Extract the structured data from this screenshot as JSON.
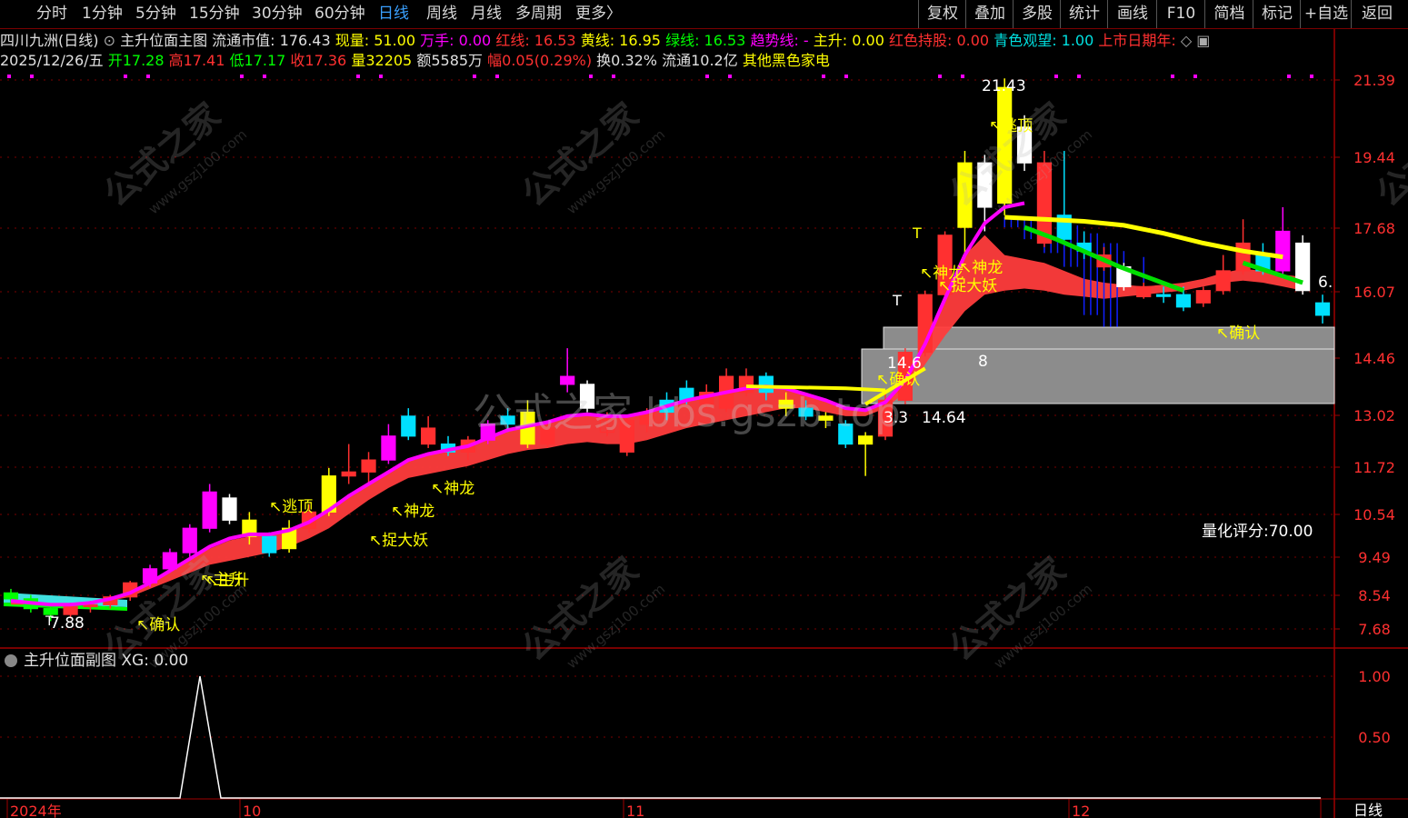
{
  "toolbar": {
    "timeframes": [
      "分时",
      "1分钟",
      "5分钟",
      "15分钟",
      "30分钟",
      "60分钟",
      "日线",
      "周线",
      "月线",
      "多周期",
      "更多"
    ],
    "active": "日线",
    "more_arrow": "〉",
    "buttons": [
      "复权",
      "叠加",
      "多股",
      "统计",
      "画线",
      "F10",
      "简档",
      "标记",
      "+自选",
      "返回"
    ]
  },
  "info_line1": {
    "stock": "四川九洲(日线)",
    "indicator": "主升位面主图",
    "items": [
      {
        "label": "流通市值: ",
        "value": "176.43",
        "color": "#e0e0e0"
      },
      {
        "label": "现量: ",
        "value": "51.00",
        "color": "#ffff00"
      },
      {
        "label": "万手: ",
        "value": "0.00",
        "color": "#ff00ff"
      },
      {
        "label": "红线: ",
        "value": "16.53",
        "color": "#ff3030"
      },
      {
        "label": "黄线: ",
        "value": "16.95",
        "color": "#ffff00"
      },
      {
        "label": "绿线: ",
        "value": "16.53",
        "color": "#00ff00"
      },
      {
        "label": "趋势线: ",
        "value": "-",
        "color": "#ff00ff"
      },
      {
        "label": "主升: ",
        "value": "0.00",
        "color": "#ffff00"
      },
      {
        "label": "红色持股: ",
        "value": "0.00",
        "color": "#ff3030"
      },
      {
        "label": "青色观望: ",
        "value": "1.00",
        "color": "#00e0e0"
      },
      {
        "label": "上市日期年: ",
        "value": "",
        "color": "#ff3030"
      }
    ]
  },
  "info_line2": {
    "date": "2025/12/26/五",
    "items": [
      {
        "label": "开",
        "value": "17.28",
        "color": "#00ff00"
      },
      {
        "label": "高",
        "value": "17.41",
        "color": "#ff3030"
      },
      {
        "label": "低",
        "value": "17.17",
        "color": "#00ff00"
      },
      {
        "label": "收",
        "value": "17.36",
        "color": "#ff3030"
      },
      {
        "label": "量",
        "value": "32205",
        "color": "#ffff00"
      },
      {
        "label": "额",
        "value": "5585万",
        "color": "#e0e0e0"
      },
      {
        "label": "幅",
        "value": "0.05(0.29%)",
        "color": "#ff3030"
      },
      {
        "label": "换",
        "value": "0.32%",
        "color": "#e0e0e0"
      },
      {
        "label": "流通",
        "value": "10.2亿",
        "color": "#e0e0e0"
      },
      {
        "label": "",
        "value": "其他黑色家电",
        "color": "#ffff00"
      }
    ]
  },
  "sub_panel": {
    "title": "主升位面副图",
    "xg_label": "XG: ",
    "xg_value": "0.00"
  },
  "period_label": "日线",
  "score": "量化评分:70.00",
  "watermark": {
    "brand": "公式之家",
    "url": "www.gszj100.com",
    "center": "公式之家 bbs.gszb.top"
  },
  "chart_data": [
    {
      "type": "candlestick",
      "price_axis_ticks": [
        21.39,
        19.44,
        17.68,
        16.07,
        14.46,
        13.02,
        11.72,
        10.54,
        9.49,
        8.54,
        7.68
      ],
      "ylim": [
        7.5,
        22.0
      ],
      "x_labels": [
        "2024年",
        "10",
        "11",
        "12"
      ],
      "candles": [
        {
          "o": 8.6,
          "h": 8.7,
          "l": 8.35,
          "c": 8.45,
          "col": "#00ff00"
        },
        {
          "o": 8.45,
          "h": 8.55,
          "l": 8.1,
          "c": 8.2,
          "col": "#00ff00"
        },
        {
          "o": 8.2,
          "h": 8.3,
          "l": 7.88,
          "c": 8.05,
          "col": "#00ff00"
        },
        {
          "o": 8.05,
          "h": 8.35,
          "l": 7.95,
          "c": 8.25,
          "col": "#ff3030"
        },
        {
          "o": 8.25,
          "h": 8.4,
          "l": 8.1,
          "c": 8.3,
          "col": "#ff3030"
        },
        {
          "o": 8.3,
          "h": 8.55,
          "l": 8.2,
          "c": 8.5,
          "col": "#ff3030"
        },
        {
          "o": 8.5,
          "h": 8.9,
          "l": 8.4,
          "c": 8.85,
          "col": "#ff3030"
        },
        {
          "o": 8.85,
          "h": 9.3,
          "l": 8.75,
          "c": 9.2,
          "col": "#ff00ff"
        },
        {
          "o": 9.2,
          "h": 9.7,
          "l": 9.1,
          "c": 9.6,
          "col": "#ff00ff"
        },
        {
          "o": 9.6,
          "h": 10.3,
          "l": 9.5,
          "c": 10.2,
          "col": "#ff00ff"
        },
        {
          "o": 10.2,
          "h": 11.3,
          "l": 10.1,
          "c": 11.1,
          "col": "#ff00ff"
        },
        {
          "o": 10.95,
          "h": 11.05,
          "l": 10.3,
          "c": 10.4,
          "col": "#ffffff"
        },
        {
          "o": 10.4,
          "h": 10.6,
          "l": 9.8,
          "c": 10.0,
          "col": "#ffff00"
        },
        {
          "o": 10.0,
          "h": 10.1,
          "l": 9.5,
          "c": 9.6,
          "col": "#00e0ff"
        },
        {
          "o": 9.7,
          "h": 10.4,
          "l": 9.6,
          "c": 10.2,
          "col": "#ffff00"
        },
        {
          "o": 10.2,
          "h": 10.8,
          "l": 10.1,
          "c": 10.6,
          "col": "#ff3030"
        },
        {
          "o": 10.6,
          "h": 11.7,
          "l": 10.5,
          "c": 11.5,
          "col": "#ffff00"
        },
        {
          "o": 11.5,
          "h": 12.3,
          "l": 11.3,
          "c": 11.6,
          "col": "#ff3030"
        },
        {
          "o": 11.6,
          "h": 12.1,
          "l": 11.3,
          "c": 11.9,
          "col": "#ff3030"
        },
        {
          "o": 11.9,
          "h": 12.8,
          "l": 11.8,
          "c": 12.5,
          "col": "#ff00ff"
        },
        {
          "o": 12.5,
          "h": 13.2,
          "l": 12.4,
          "c": 13.0,
          "col": "#00e0ff"
        },
        {
          "o": 12.7,
          "h": 13.0,
          "l": 12.2,
          "c": 12.3,
          "col": "#ff3030"
        },
        {
          "o": 12.3,
          "h": 12.5,
          "l": 12.0,
          "c": 12.1,
          "col": "#00e0ff"
        },
        {
          "o": 12.1,
          "h": 12.5,
          "l": 11.9,
          "c": 12.4,
          "col": "#ff3030"
        },
        {
          "o": 12.4,
          "h": 12.9,
          "l": 12.3,
          "c": 12.8,
          "col": "#ff00ff"
        },
        {
          "o": 12.8,
          "h": 13.2,
          "l": 12.6,
          "c": 13.0,
          "col": "#00e0ff"
        },
        {
          "o": 13.1,
          "h": 13.4,
          "l": 12.2,
          "c": 12.3,
          "col": "#ffff00"
        },
        {
          "o": 12.3,
          "h": 12.8,
          "l": 12.2,
          "c": 12.7,
          "col": "#ff3030"
        },
        {
          "o": 14.0,
          "h": 14.7,
          "l": 13.6,
          "c": 13.8,
          "col": "#ff00ff"
        },
        {
          "o": 13.8,
          "h": 13.9,
          "l": 13.1,
          "c": 13.2,
          "col": "#ffffff"
        },
        {
          "o": 12.6,
          "h": 13.1,
          "l": 12.5,
          "c": 12.9,
          "col": "#ff3030"
        },
        {
          "o": 12.9,
          "h": 13.0,
          "l": 12.0,
          "c": 12.1,
          "col": "#ff3030"
        },
        {
          "o": 12.8,
          "h": 13.2,
          "l": 12.6,
          "c": 13.1,
          "col": "#ff3030"
        },
        {
          "o": 13.1,
          "h": 13.6,
          "l": 12.9,
          "c": 13.4,
          "col": "#00e0ff"
        },
        {
          "o": 13.4,
          "h": 13.9,
          "l": 13.3,
          "c": 13.7,
          "col": "#00e0ff"
        },
        {
          "o": 13.6,
          "h": 13.8,
          "l": 13.2,
          "c": 13.3,
          "col": "#ff3030"
        },
        {
          "o": 13.2,
          "h": 14.2,
          "l": 13.1,
          "c": 14.0,
          "col": "#ff3030"
        },
        {
          "o": 14.0,
          "h": 14.2,
          "l": 13.5,
          "c": 13.6,
          "col": "#ff3030"
        },
        {
          "o": 13.6,
          "h": 14.1,
          "l": 13.4,
          "c": 14.0,
          "col": "#00e0ff"
        },
        {
          "o": 13.4,
          "h": 13.6,
          "l": 13.0,
          "c": 13.2,
          "col": "#ffff00"
        },
        {
          "o": 13.2,
          "h": 13.4,
          "l": 12.9,
          "c": 13.0,
          "col": "#00e0ff"
        },
        {
          "o": 13.0,
          "h": 13.1,
          "l": 12.7,
          "c": 12.9,
          "col": "#ffff00"
        },
        {
          "o": 12.8,
          "h": 12.9,
          "l": 12.2,
          "c": 12.3,
          "col": "#00e0ff"
        },
        {
          "o": 12.3,
          "h": 12.6,
          "l": 11.5,
          "c": 12.5,
          "col": "#ffff00"
        },
        {
          "o": 12.5,
          "h": 13.6,
          "l": 12.4,
          "c": 13.4,
          "col": "#ff3030"
        },
        {
          "o": 13.4,
          "h": 14.7,
          "l": 13.3,
          "c": 14.6,
          "col": "#ff3030"
        },
        {
          "o": 14.6,
          "h": 16.1,
          "l": 14.5,
          "c": 16.0,
          "col": "#ff3030"
        },
        {
          "o": 16.0,
          "h": 17.6,
          "l": 15.9,
          "c": 17.5,
          "col": "#ff3030"
        },
        {
          "o": 17.7,
          "h": 19.6,
          "l": 17.0,
          "c": 19.3,
          "col": "#ffff00"
        },
        {
          "o": 19.3,
          "h": 19.5,
          "l": 17.6,
          "c": 18.2,
          "col": "#ffffff"
        },
        {
          "o": 18.3,
          "h": 21.43,
          "l": 18.0,
          "c": 21.2,
          "col": "#ffff00"
        },
        {
          "o": 20.2,
          "h": 20.5,
          "l": 19.1,
          "c": 19.3,
          "col": "#ffffff"
        },
        {
          "o": 19.3,
          "h": 19.6,
          "l": 17.2,
          "c": 17.3,
          "col": "#ff3030"
        },
        {
          "o": 17.4,
          "h": 19.6,
          "l": 17.3,
          "c": 18.0,
          "col": "#00e0ff"
        },
        {
          "o": 17.3,
          "h": 17.6,
          "l": 16.9,
          "c": 17.1,
          "col": "#00e0ff"
        },
        {
          "o": 17.0,
          "h": 17.2,
          "l": 16.6,
          "c": 16.7,
          "col": "#ff3030"
        },
        {
          "o": 16.7,
          "h": 16.8,
          "l": 16.1,
          "c": 16.2,
          "col": "#ffffff"
        },
        {
          "o": 16.2,
          "h": 16.3,
          "l": 15.9,
          "c": 15.95,
          "col": "#ff3030"
        },
        {
          "o": 16.0,
          "h": 16.2,
          "l": 15.8,
          "c": 16.0,
          "col": "#00e0ff"
        },
        {
          "o": 16.0,
          "h": 16.2,
          "l": 15.6,
          "c": 15.7,
          "col": "#00e0ff"
        },
        {
          "o": 15.8,
          "h": 16.2,
          "l": 15.7,
          "c": 16.1,
          "col": "#ff3030"
        },
        {
          "o": 16.1,
          "h": 17.0,
          "l": 16.0,
          "c": 16.6,
          "col": "#ff3030"
        },
        {
          "o": 16.6,
          "h": 17.9,
          "l": 16.5,
          "c": 17.3,
          "col": "#ff3030"
        },
        {
          "o": 17.0,
          "h": 17.3,
          "l": 16.5,
          "c": 16.6,
          "col": "#00e0ff"
        },
        {
          "o": 16.6,
          "h": 18.2,
          "l": 16.4,
          "c": 17.6,
          "col": "#ff00ff"
        },
        {
          "o": 17.3,
          "h": 17.5,
          "l": 16.0,
          "c": 16.1,
          "col": "#ffffff"
        },
        {
          "o": 15.8,
          "h": 16.0,
          "l": 15.3,
          "c": 15.5,
          "col": "#00e0ff"
        }
      ],
      "trend_line": [
        8.4,
        8.35,
        8.3,
        8.3,
        8.35,
        8.45,
        8.6,
        8.85,
        9.15,
        9.45,
        9.75,
        9.95,
        10.05,
        10.05,
        10.15,
        10.35,
        10.65,
        11.0,
        11.3,
        11.6,
        11.9,
        12.05,
        12.15,
        12.25,
        12.45,
        12.65,
        12.75,
        12.85,
        13.0,
        13.05,
        13.0,
        13.0,
        13.1,
        13.25,
        13.4,
        13.5,
        13.6,
        13.7,
        13.75,
        13.7,
        13.55,
        13.4,
        13.2,
        13.15,
        13.35,
        13.9,
        14.8,
        15.9,
        17.0,
        17.8,
        18.2,
        18.3
      ],
      "yellow_line": [
        17.95,
        17.9,
        17.85,
        17.75,
        17.55,
        17.3,
        17.1,
        16.95
      ],
      "green_line": [
        17.7,
        17.4,
        17.05,
        16.7,
        16.4,
        16.1
      ],
      "band_upper": [
        8.4,
        8.35,
        8.32,
        8.32,
        8.35,
        8.45,
        8.6,
        8.85,
        9.15,
        9.45,
        9.7,
        9.9,
        10.0,
        10.05,
        10.15,
        10.35,
        10.65,
        11.0,
        11.3,
        11.6,
        11.9,
        12.05,
        12.15,
        12.25,
        12.45,
        12.65,
        12.75,
        12.85,
        13.0,
        13.05,
        13.0,
        13.0,
        13.1,
        13.25,
        13.4,
        13.5,
        13.6,
        13.7,
        13.75,
        13.7,
        13.55,
        13.4,
        13.2,
        13.15,
        13.35,
        13.9,
        14.8,
        15.9,
        17.0,
        17.5,
        17.0,
        16.9,
        16.8,
        16.6,
        16.4,
        16.3,
        16.25,
        16.2,
        16.25,
        16.3,
        16.4,
        16.55,
        16.65,
        16.6,
        16.5,
        16.45
      ],
      "band_lower": [
        8.3,
        8.3,
        8.3,
        8.3,
        8.35,
        8.4,
        8.5,
        8.7,
        8.9,
        9.1,
        9.3,
        9.4,
        9.5,
        9.6,
        9.75,
        9.95,
        10.2,
        10.55,
        10.9,
        11.2,
        11.45,
        11.55,
        11.65,
        11.75,
        11.9,
        12.05,
        12.15,
        12.2,
        12.3,
        12.35,
        12.3,
        12.3,
        12.4,
        12.55,
        12.7,
        12.8,
        12.9,
        13.0,
        13.1,
        13.2,
        13.2,
        13.1,
        13.0,
        13.0,
        13.2,
        13.6,
        14.3,
        15.0,
        15.6,
        16.0,
        16.1,
        16.15,
        16.1,
        16.0,
        15.95,
        15.9,
        15.95,
        16.0,
        16.05,
        16.1,
        16.2,
        16.3,
        16.35,
        16.3,
        16.2,
        16.1
      ],
      "annotations": [
        "21.43",
        "逃顶",
        "逃顶",
        "神龙",
        "神龙",
        "神龙",
        "神龙",
        "捉大妖",
        "捉大妖",
        "确认",
        "确认",
        "确认",
        "主升",
        "7.88",
        "14.64",
        "14.6",
        "8",
        "3.3",
        "6."
      ],
      "gray_zones": [
        {
          "from": {
            "x": 948,
            "y": 384
          },
          "to": {
            "x": 1468,
            "y": 444
          }
        },
        {
          "from": {
            "x": 972,
            "y": 360
          },
          "to": {
            "x": 1468,
            "y": 384
          }
        }
      ]
    },
    {
      "type": "line",
      "name": "XG",
      "ylim": [
        0,
        1.2
      ],
      "y_ticks": [
        1.0,
        0.5
      ],
      "values": [
        0,
        0,
        0,
        0,
        0,
        0,
        0,
        0,
        0,
        0,
        0,
        0,
        0,
        0,
        0,
        0,
        0,
        0,
        1,
        0,
        0,
        0,
        0,
        0,
        0,
        0,
        0,
        0,
        0,
        0,
        0,
        0,
        0,
        0,
        0,
        0,
        0,
        0,
        0,
        0,
        0,
        0,
        0,
        0,
        0,
        0,
        0,
        0,
        0,
        0,
        0,
        0,
        0,
        0,
        0,
        0,
        0,
        0,
        0,
        0,
        0,
        0,
        0,
        0,
        0,
        0
      ]
    }
  ]
}
